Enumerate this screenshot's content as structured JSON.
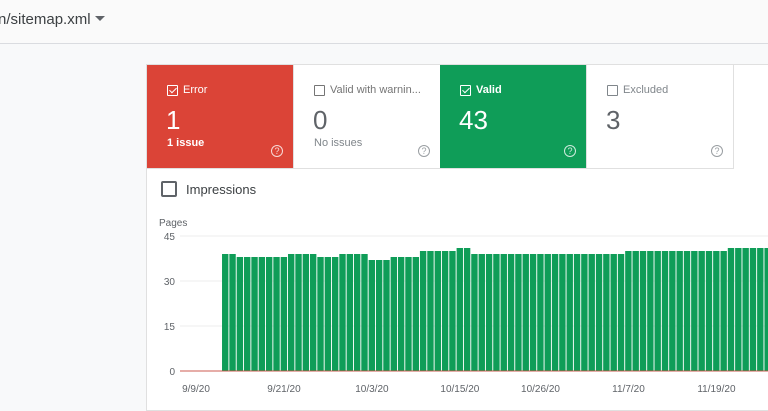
{
  "header": {
    "sitemap": "n/sitemap.xml",
    "dropdown_icon": "caret-down-icon"
  },
  "cards": [
    {
      "label": "Error",
      "checked": true,
      "count": "1",
      "sub": "1 issue",
      "color": "#db4437"
    },
    {
      "label": "Valid with warnin...",
      "checked": false,
      "count": "0",
      "sub": "No issues"
    },
    {
      "label": "Valid",
      "checked": true,
      "count": "43",
      "sub": "",
      "color": "#0f9d58"
    },
    {
      "label": "Excluded",
      "checked": false,
      "count": "3",
      "sub": ""
    }
  ],
  "help_icon": "?",
  "impressions": {
    "label": "Impressions",
    "checked": false
  },
  "chart_data": {
    "type": "bar",
    "ylabel": "Pages",
    "ylim": [
      0,
      45
    ],
    "yticks": [
      0,
      15,
      30,
      45
    ],
    "xticks": [
      "9/9/20",
      "9/21/20",
      "10/3/20",
      "10/15/20",
      "10/26/20",
      "11/7/20",
      "11/19/20"
    ],
    "grid": true,
    "series": [
      {
        "color": "#0f9d58",
        "start": "9/13/20",
        "values": [
          39,
          39,
          38,
          38,
          38,
          38,
          38,
          38,
          38,
          39,
          39,
          39,
          39,
          38,
          38,
          38,
          39,
          39,
          39,
          39,
          37,
          37,
          37,
          38,
          38,
          38,
          38,
          40,
          40,
          40,
          40,
          40,
          41,
          41,
          39,
          39,
          39,
          39,
          39,
          39,
          39,
          39,
          39,
          39,
          39,
          39,
          39,
          39,
          39,
          39,
          39,
          39,
          39,
          39,
          39,
          40,
          40,
          40,
          40,
          40,
          40,
          40,
          40,
          40,
          40,
          40,
          40,
          40,
          40,
          41,
          41,
          41,
          41,
          41,
          41
        ]
      }
    ]
  }
}
